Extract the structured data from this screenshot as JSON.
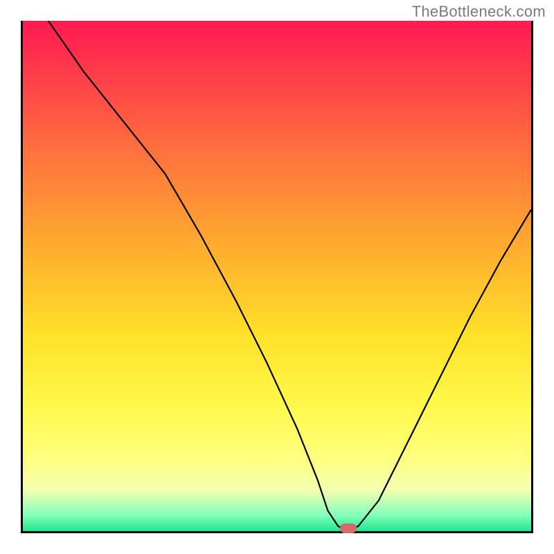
{
  "attribution": "TheBottleneck.com",
  "chart_data": {
    "type": "line",
    "title": "",
    "xlabel": "",
    "ylabel": "",
    "xlim": [
      0,
      100
    ],
    "ylim": [
      0,
      100
    ],
    "grid": false,
    "legend": false,
    "background": "red-yellow-green vertical gradient",
    "series": [
      {
        "name": "bottleneck-curve",
        "color": "#000000",
        "x": [
          5,
          12,
          20,
          28,
          35,
          42,
          48,
          54,
          58,
          60,
          62,
          64,
          66,
          70,
          76,
          82,
          88,
          94,
          100
        ],
        "y": [
          100,
          90,
          80,
          70,
          58,
          45,
          33,
          20,
          10,
          4,
          1,
          0,
          1,
          6,
          18,
          30,
          42,
          53,
          63
        ]
      }
    ],
    "marker": {
      "x": 64,
      "y": 0.5,
      "shape": "pill",
      "color": "#d46a6a"
    }
  }
}
